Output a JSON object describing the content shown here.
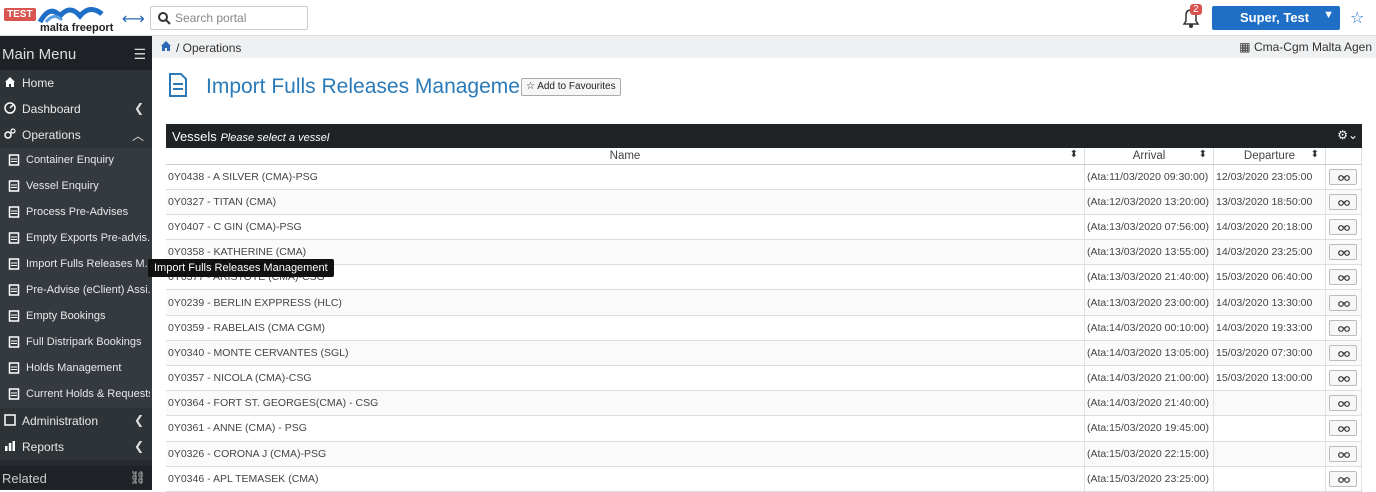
{
  "header": {
    "env_badge": "TEST",
    "logo_text": "malta freeport",
    "search_placeholder": "Search portal",
    "notification_count": "2",
    "user_name": "Super, Test"
  },
  "sidebar": {
    "title": "Main Menu",
    "items": [
      {
        "label": "Home",
        "icon": "home-icon"
      },
      {
        "label": "Dashboard",
        "icon": "dashboard-icon"
      },
      {
        "label": "Operations",
        "icon": "cogs-icon"
      },
      {
        "label": "Container Enquiry",
        "icon": "document-icon"
      },
      {
        "label": "Vessel Enquiry",
        "icon": "document-icon"
      },
      {
        "label": "Process Pre-Advises",
        "icon": "document-icon"
      },
      {
        "label": "Empty Exports Pre-advis...",
        "icon": "document-icon"
      },
      {
        "label": "Import Fulls Releases M...",
        "icon": "document-icon"
      },
      {
        "label": "Pre-Advise (eClient) Assi...",
        "icon": "document-icon"
      },
      {
        "label": "Empty Bookings",
        "icon": "document-icon"
      },
      {
        "label": "Full Distripark Bookings",
        "icon": "document-icon"
      },
      {
        "label": "Holds Management",
        "icon": "document-icon"
      },
      {
        "label": "Current Holds & Requests",
        "icon": "document-icon"
      },
      {
        "label": "Administration",
        "icon": "window-icon"
      },
      {
        "label": "Reports",
        "icon": "bar-chart-icon"
      }
    ],
    "related_label": "Related",
    "tooltip": "Import Fulls Releases Management"
  },
  "breadcrumb": {
    "current": "Operations",
    "agency": "Cma-Cgm Malta Agen"
  },
  "page": {
    "title": "Import Fulls Releases Management",
    "fav_label": "Add to Favourites"
  },
  "vessels": {
    "title": "Vessels",
    "subtitle": "Please select a vessel",
    "columns": [
      "Name",
      "Arrival",
      "Departure"
    ],
    "rows": [
      {
        "name": "0Y0438 - A SILVER (CMA)-PSG",
        "arrival": "(Ata:11/03/2020 09:30:00)",
        "departure": "12/03/2020 23:05:00"
      },
      {
        "name": "0Y0327 - TITAN (CMA)",
        "arrival": "(Ata:12/03/2020 13:20:00)",
        "departure": "13/03/2020 18:50:00"
      },
      {
        "name": "0Y0407 - C GIN (CMA)-PSG",
        "arrival": "(Ata:13/03/2020 07:56:00)",
        "departure": "14/03/2020 20:18:00"
      },
      {
        "name": "0Y0358 - KATHERINE (CMA)",
        "arrival": "(Ata:13/03/2020 13:55:00)",
        "departure": "14/03/2020 23:25:00"
      },
      {
        "name": "0Y0377 - ARISTOTE (CMA)-CSG",
        "arrival": "(Ata:13/03/2020 21:40:00)",
        "departure": "15/03/2020 06:40:00"
      },
      {
        "name": "0Y0239 - BERLIN EXPPRESS (HLC)",
        "arrival": "(Ata:13/03/2020 23:00:00)",
        "departure": "14/03/2020 13:30:00"
      },
      {
        "name": "0Y0359 - RABELAIS (CMA CGM)",
        "arrival": "(Ata:14/03/2020 00:10:00)",
        "departure": "14/03/2020 19:33:00"
      },
      {
        "name": "0Y0340 - MONTE CERVANTES (SGL)",
        "arrival": "(Ata:14/03/2020 13:05:00)",
        "departure": "15/03/2020 07:30:00"
      },
      {
        "name": "0Y0357 - NICOLA (CMA)-CSG",
        "arrival": "(Ata:14/03/2020 21:00:00)",
        "departure": "15/03/2020 13:00:00"
      },
      {
        "name": "0Y0364 - FORT ST. GEORGES(CMA) - CSG",
        "arrival": "(Ata:14/03/2020 21:40:00)",
        "departure": ""
      },
      {
        "name": "0Y0361 - ANNE (CMA) - PSG",
        "arrival": "(Ata:15/03/2020 19:45:00)",
        "departure": ""
      },
      {
        "name": "0Y0326 - CORONA J (CMA)-PSG",
        "arrival": "(Ata:15/03/2020 22:15:00)",
        "departure": ""
      },
      {
        "name": "0Y0346 - APL TEMASEK (CMA)",
        "arrival": "(Ata:15/03/2020 23:25:00)",
        "departure": ""
      }
    ]
  },
  "colors": {
    "accent": "#1f6fc6",
    "sidebar_bg": "#262a2e",
    "title_blue": "#2a7ab8",
    "badge_red": "#d9534f"
  }
}
